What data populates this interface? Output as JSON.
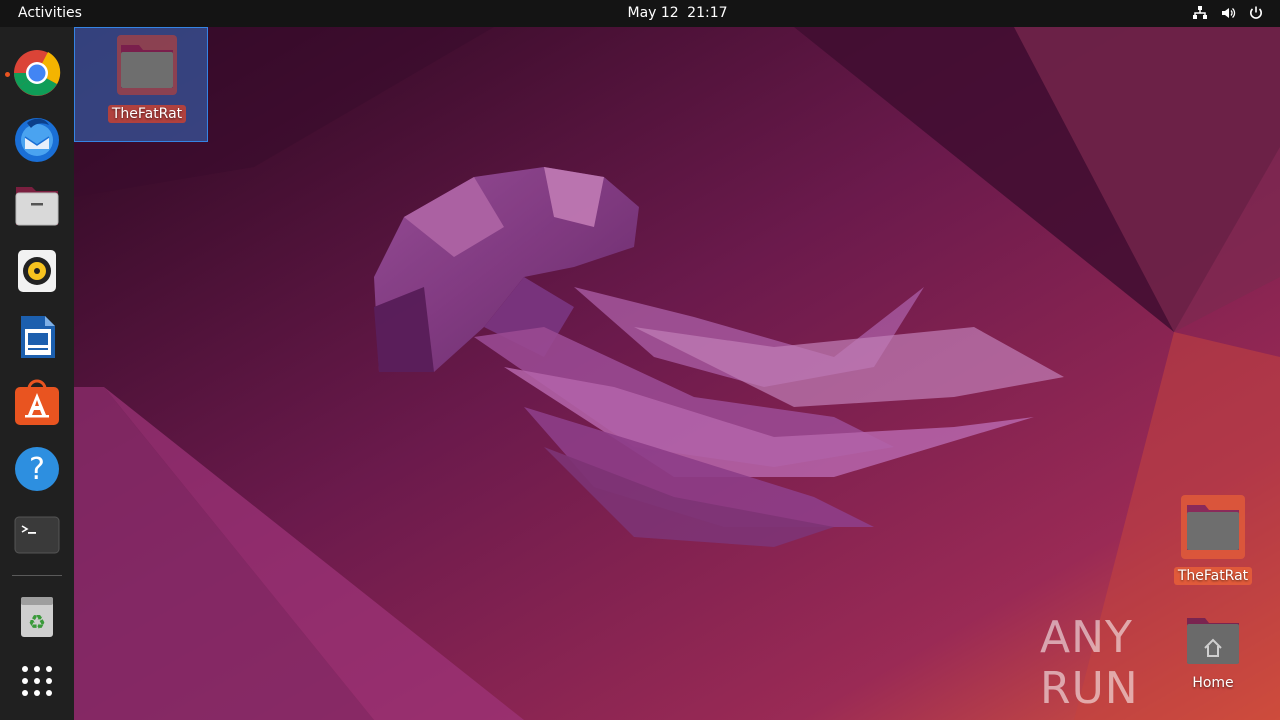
{
  "topbar": {
    "activities_label": "Activities",
    "date": "May 12",
    "time": "21:17"
  },
  "dock": {
    "items": [
      {
        "name": "Google Chrome",
        "icon": "chrome-icon",
        "running": true
      },
      {
        "name": "Thunderbird Mail",
        "icon": "thunderbird-icon"
      },
      {
        "name": "Files",
        "icon": "files-icon"
      },
      {
        "name": "Rhythmbox",
        "icon": "rhythmbox-icon"
      },
      {
        "name": "LibreOffice Writer",
        "icon": "writer-icon"
      },
      {
        "name": "Ubuntu Software",
        "icon": "software-icon"
      },
      {
        "name": "Help",
        "icon": "help-icon"
      },
      {
        "name": "Terminal",
        "icon": "terminal-icon"
      },
      {
        "name": "Trash",
        "icon": "trash-icon"
      },
      {
        "name": "Show Applications",
        "icon": "app-grid-icon"
      }
    ]
  },
  "desktop": {
    "icons": [
      {
        "label": "TheFatRat",
        "icon": "folder-icon",
        "selected": true
      },
      {
        "label": "TheFatRat",
        "icon": "folder-icon",
        "selected": false
      },
      {
        "label": "Home",
        "icon": "home-folder-icon",
        "selected": false
      }
    ]
  },
  "watermark": "ANY RUN",
  "colors": {
    "topbar": "#141414",
    "dock": "#202020",
    "accent": "#e95420",
    "selection": "#3584e4"
  }
}
